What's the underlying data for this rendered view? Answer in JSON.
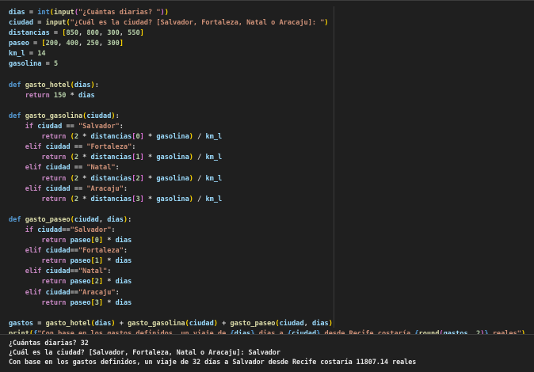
{
  "editor": {
    "lines": [
      [
        [
          "t-var",
          "dias"
        ],
        [
          "t-op",
          " = "
        ],
        [
          "t-def",
          "int"
        ],
        [
          "t-br1",
          "("
        ],
        [
          "t-fn",
          "input"
        ],
        [
          "t-br2",
          "("
        ],
        [
          "t-str",
          "\"¿Cuántas diarias? \""
        ],
        [
          "t-br2",
          ")"
        ],
        [
          "t-br1",
          ")"
        ]
      ],
      [
        [
          "t-var",
          "ciudad"
        ],
        [
          "t-op",
          " = "
        ],
        [
          "t-fn",
          "input"
        ],
        [
          "t-br1",
          "("
        ],
        [
          "t-str",
          "\"¿Cuál es la ciudad? [Salvador, Fortaleza, Natal o Aracaju]: \""
        ],
        [
          "t-br1",
          ")"
        ]
      ],
      [
        [
          "t-var",
          "distancias"
        ],
        [
          "t-op",
          " = "
        ],
        [
          "t-br1",
          "["
        ],
        [
          "t-num",
          "850"
        ],
        [
          "t-op",
          ", "
        ],
        [
          "t-num",
          "800"
        ],
        [
          "t-op",
          ", "
        ],
        [
          "t-num",
          "300"
        ],
        [
          "t-op",
          ", "
        ],
        [
          "t-num",
          "550"
        ],
        [
          "t-br1",
          "]"
        ]
      ],
      [
        [
          "t-var",
          "paseo"
        ],
        [
          "t-op",
          " = "
        ],
        [
          "t-br1",
          "["
        ],
        [
          "t-num",
          "200"
        ],
        [
          "t-op",
          ", "
        ],
        [
          "t-num",
          "400"
        ],
        [
          "t-op",
          ", "
        ],
        [
          "t-num",
          "250"
        ],
        [
          "t-op",
          ", "
        ],
        [
          "t-num",
          "300"
        ],
        [
          "t-br1",
          "]"
        ]
      ],
      [
        [
          "t-var",
          "km_l"
        ],
        [
          "t-op",
          " = "
        ],
        [
          "t-num",
          "14"
        ]
      ],
      [
        [
          "t-var",
          "gasolina"
        ],
        [
          "t-op",
          " = "
        ],
        [
          "t-num",
          "5"
        ]
      ],
      [],
      [
        [
          "t-def",
          "def "
        ],
        [
          "t-fn",
          "gasto_hotel"
        ],
        [
          "t-br1",
          "("
        ],
        [
          "t-var",
          "dias"
        ],
        [
          "t-br1",
          ")"
        ],
        [
          "t-op",
          ":"
        ]
      ],
      [
        [
          "t-op",
          "    "
        ],
        [
          "t-kw",
          "return "
        ],
        [
          "t-num",
          "150"
        ],
        [
          "t-op",
          " * "
        ],
        [
          "t-var",
          "dias"
        ]
      ],
      [],
      [
        [
          "t-def",
          "def "
        ],
        [
          "t-fn",
          "gasto_gasolina"
        ],
        [
          "t-br1",
          "("
        ],
        [
          "t-var",
          "ciudad"
        ],
        [
          "t-br1",
          ")"
        ],
        [
          "t-op",
          ":"
        ]
      ],
      [
        [
          "t-op",
          "    "
        ],
        [
          "t-kw",
          "if "
        ],
        [
          "t-var",
          "ciudad"
        ],
        [
          "t-op",
          " == "
        ],
        [
          "t-str",
          "\"Salvador\""
        ],
        [
          "t-op",
          ":"
        ]
      ],
      [
        [
          "t-op",
          "        "
        ],
        [
          "t-kw",
          "return "
        ],
        [
          "t-br1",
          "("
        ],
        [
          "t-num",
          "2"
        ],
        [
          "t-op",
          " * "
        ],
        [
          "t-var",
          "distancias"
        ],
        [
          "t-br2",
          "["
        ],
        [
          "t-num",
          "0"
        ],
        [
          "t-br2",
          "]"
        ],
        [
          "t-op",
          " * "
        ],
        [
          "t-var",
          "gasolina"
        ],
        [
          "t-br1",
          ")"
        ],
        [
          "t-op",
          " / "
        ],
        [
          "t-var",
          "km_l"
        ]
      ],
      [
        [
          "t-op",
          "    "
        ],
        [
          "t-kw",
          "elif "
        ],
        [
          "t-var",
          "ciudad"
        ],
        [
          "t-op",
          " == "
        ],
        [
          "t-str",
          "\"Fortaleza\""
        ],
        [
          "t-op",
          ":"
        ]
      ],
      [
        [
          "t-op",
          "        "
        ],
        [
          "t-kw",
          "return "
        ],
        [
          "t-br1",
          "("
        ],
        [
          "t-num",
          "2"
        ],
        [
          "t-op",
          " * "
        ],
        [
          "t-var",
          "distancias"
        ],
        [
          "t-br2",
          "["
        ],
        [
          "t-num",
          "1"
        ],
        [
          "t-br2",
          "]"
        ],
        [
          "t-op",
          " * "
        ],
        [
          "t-var",
          "gasolina"
        ],
        [
          "t-br1",
          ")"
        ],
        [
          "t-op",
          " / "
        ],
        [
          "t-var",
          "km_l"
        ]
      ],
      [
        [
          "t-op",
          "    "
        ],
        [
          "t-kw",
          "elif "
        ],
        [
          "t-var",
          "ciudad"
        ],
        [
          "t-op",
          " == "
        ],
        [
          "t-str",
          "\"Natal\""
        ],
        [
          "t-op",
          ":"
        ]
      ],
      [
        [
          "t-op",
          "        "
        ],
        [
          "t-kw",
          "return "
        ],
        [
          "t-br1",
          "("
        ],
        [
          "t-num",
          "2"
        ],
        [
          "t-op",
          " * "
        ],
        [
          "t-var",
          "distancias"
        ],
        [
          "t-br2",
          "["
        ],
        [
          "t-num",
          "2"
        ],
        [
          "t-br2",
          "]"
        ],
        [
          "t-op",
          " * "
        ],
        [
          "t-var",
          "gasolina"
        ],
        [
          "t-br1",
          ")"
        ],
        [
          "t-op",
          " / "
        ],
        [
          "t-var",
          "km_l"
        ]
      ],
      [
        [
          "t-op",
          "    "
        ],
        [
          "t-kw",
          "elif "
        ],
        [
          "t-var",
          "ciudad"
        ],
        [
          "t-op",
          " == "
        ],
        [
          "t-str",
          "\"Aracaju\""
        ],
        [
          "t-op",
          ":"
        ]
      ],
      [
        [
          "t-op",
          "        "
        ],
        [
          "t-kw",
          "return "
        ],
        [
          "t-br1",
          "("
        ],
        [
          "t-num",
          "2"
        ],
        [
          "t-op",
          " * "
        ],
        [
          "t-var",
          "distancias"
        ],
        [
          "t-br2",
          "["
        ],
        [
          "t-num",
          "3"
        ],
        [
          "t-br2",
          "]"
        ],
        [
          "t-op",
          " * "
        ],
        [
          "t-var",
          "gasolina"
        ],
        [
          "t-br1",
          ")"
        ],
        [
          "t-op",
          " / "
        ],
        [
          "t-var",
          "km_l"
        ]
      ],
      [],
      [
        [
          "t-def",
          "def "
        ],
        [
          "t-fn",
          "gasto_paseo"
        ],
        [
          "t-br1",
          "("
        ],
        [
          "t-var",
          "ciudad"
        ],
        [
          "t-op",
          ", "
        ],
        [
          "t-var",
          "dias"
        ],
        [
          "t-br1",
          ")"
        ],
        [
          "t-op",
          ":"
        ]
      ],
      [
        [
          "t-op",
          "    "
        ],
        [
          "t-kw",
          "if "
        ],
        [
          "t-var",
          "ciudad"
        ],
        [
          "t-op",
          "=="
        ],
        [
          "t-str",
          "\"Salvador\""
        ],
        [
          "t-op",
          ":"
        ]
      ],
      [
        [
          "t-op",
          "        "
        ],
        [
          "t-kw",
          "return "
        ],
        [
          "t-var",
          "paseo"
        ],
        [
          "t-br1",
          "["
        ],
        [
          "t-num",
          "0"
        ],
        [
          "t-br1",
          "]"
        ],
        [
          "t-op",
          " * "
        ],
        [
          "t-var",
          "dias"
        ]
      ],
      [
        [
          "t-op",
          "    "
        ],
        [
          "t-kw",
          "elif "
        ],
        [
          "t-var",
          "ciudad"
        ],
        [
          "t-op",
          "=="
        ],
        [
          "t-str",
          "\"Fortaleza\""
        ],
        [
          "t-op",
          ":"
        ]
      ],
      [
        [
          "t-op",
          "        "
        ],
        [
          "t-kw",
          "return "
        ],
        [
          "t-var",
          "paseo"
        ],
        [
          "t-br1",
          "["
        ],
        [
          "t-num",
          "1"
        ],
        [
          "t-br1",
          "]"
        ],
        [
          "t-op",
          " * "
        ],
        [
          "t-var",
          "dias"
        ]
      ],
      [
        [
          "t-op",
          "    "
        ],
        [
          "t-kw",
          "elif "
        ],
        [
          "t-var",
          "ciudad"
        ],
        [
          "t-op",
          "=="
        ],
        [
          "t-str",
          "\"Natal\""
        ],
        [
          "t-op",
          ":"
        ]
      ],
      [
        [
          "t-op",
          "        "
        ],
        [
          "t-kw",
          "return "
        ],
        [
          "t-var",
          "paseo"
        ],
        [
          "t-br1",
          "["
        ],
        [
          "t-num",
          "2"
        ],
        [
          "t-br1",
          "]"
        ],
        [
          "t-op",
          " * "
        ],
        [
          "t-var",
          "dias"
        ]
      ],
      [
        [
          "t-op",
          "    "
        ],
        [
          "t-kw",
          "elif "
        ],
        [
          "t-var",
          "ciudad"
        ],
        [
          "t-op",
          "=="
        ],
        [
          "t-str",
          "\"Aracaju\""
        ],
        [
          "t-op",
          ":"
        ]
      ],
      [
        [
          "t-op",
          "        "
        ],
        [
          "t-kw",
          "return "
        ],
        [
          "t-var",
          "paseo"
        ],
        [
          "t-br1",
          "["
        ],
        [
          "t-num",
          "3"
        ],
        [
          "t-br1",
          "]"
        ],
        [
          "t-op",
          " * "
        ],
        [
          "t-var",
          "dias"
        ]
      ],
      [],
      [
        [
          "t-var",
          "gastos"
        ],
        [
          "t-op",
          " = "
        ],
        [
          "t-fn",
          "gasto_hotel"
        ],
        [
          "t-br1",
          "("
        ],
        [
          "t-var",
          "dias"
        ],
        [
          "t-br1",
          ")"
        ],
        [
          "t-op",
          " + "
        ],
        [
          "t-fn",
          "gasto_gasolina"
        ],
        [
          "t-br1",
          "("
        ],
        [
          "t-var",
          "ciudad"
        ],
        [
          "t-br1",
          ")"
        ],
        [
          "t-op",
          " + "
        ],
        [
          "t-fn",
          "gasto_paseo"
        ],
        [
          "t-br1",
          "("
        ],
        [
          "t-var",
          "ciudad"
        ],
        [
          "t-op",
          ", "
        ],
        [
          "t-var",
          "dias"
        ],
        [
          "t-br1",
          ")"
        ]
      ],
      [
        [
          "t-fn",
          "print"
        ],
        [
          "t-br1",
          "("
        ],
        [
          "t-fmt",
          "f"
        ],
        [
          "t-str",
          "\"Con base en los gastos definidos, un viaje de "
        ],
        [
          "t-fmt",
          "{"
        ],
        [
          "t-var",
          "dias"
        ],
        [
          "t-fmt",
          "}"
        ],
        [
          "t-str",
          " dias a "
        ],
        [
          "t-fmt",
          "{"
        ],
        [
          "t-var",
          "ciudad"
        ],
        [
          "t-fmt",
          "}"
        ],
        [
          "t-str",
          " desde Recife costaría "
        ],
        [
          "t-fmt",
          "{"
        ],
        [
          "t-fn",
          "round"
        ],
        [
          "t-br2",
          "("
        ],
        [
          "t-var",
          "gastos"
        ],
        [
          "t-op",
          ", "
        ],
        [
          "t-num",
          "2"
        ],
        [
          "t-br2",
          ")"
        ],
        [
          "t-fmt",
          "}"
        ],
        [
          "t-str",
          " reales\""
        ],
        [
          "t-br1",
          ")"
        ]
      ]
    ]
  },
  "terminal": {
    "line1": "¿Cuántas diarias? 32",
    "line2": "¿Cuál es la ciudad? [Salvador, Fortaleza, Natal o Aracaju]: Salvador",
    "line3": "Con base en los gastos definidos, un viaje de 32 días a Salvador desde Recife costaría 11807.14 reales"
  }
}
